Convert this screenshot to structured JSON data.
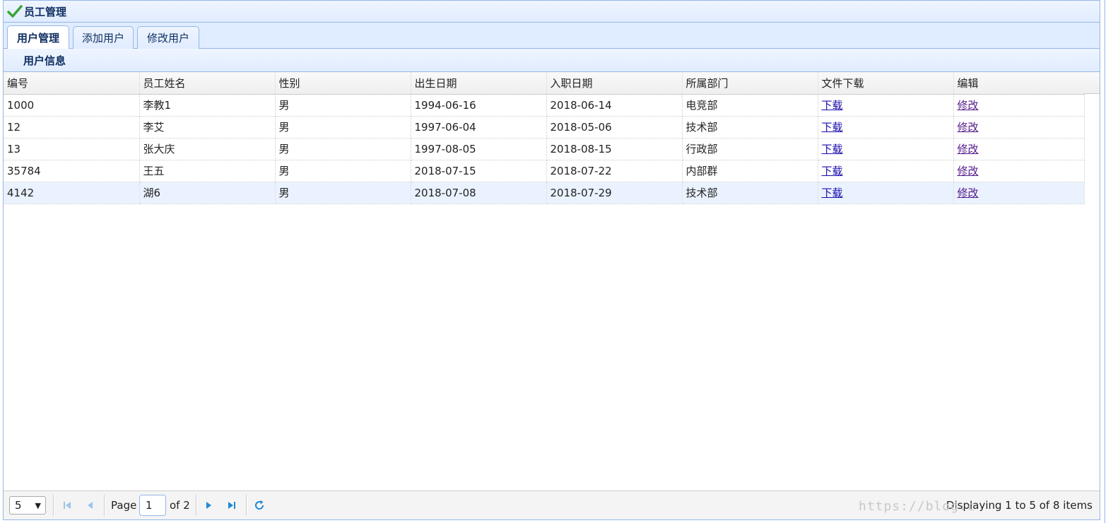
{
  "panel": {
    "title": "员工管理",
    "icon": "check-icon",
    "accent": "#95b8e7"
  },
  "tabs": [
    {
      "label": "用户管理",
      "active": true
    },
    {
      "label": "添加用户",
      "active": false
    },
    {
      "label": "修改用户",
      "active": false
    }
  ],
  "sub_panel": {
    "title": "用户信息"
  },
  "grid": {
    "columns": [
      "编号",
      "员工姓名",
      "性别",
      "出生日期",
      "入职日期",
      "所属部门",
      "文件下载",
      "编辑"
    ],
    "rows": [
      [
        "1000",
        "李教1",
        "男",
        "1994-06-16",
        "2018-06-14",
        "电竞部",
        "下载",
        "修改"
      ],
      [
        "12",
        "李艾",
        "男",
        "1997-06-04",
        "2018-05-06",
        "技术部",
        "下载",
        "修改"
      ],
      [
        "13",
        "张大庆",
        "男",
        "1997-08-05",
        "2018-08-15",
        "行政部",
        "下载",
        "修改"
      ],
      [
        "35784",
        "王五",
        "男",
        "2018-07-15",
        "2018-07-22",
        "内部群",
        "下载",
        "修改"
      ],
      [
        "4142",
        "湖6",
        "男",
        "2018-07-08",
        "2018-07-29",
        "技术部",
        "下载",
        "修改"
      ]
    ],
    "highlighted_row": 4
  },
  "pager": {
    "page_size": "5",
    "page_label": "Page",
    "current_page": "1",
    "of_label": "of 2",
    "display_text": "Displaying 1 to 5 of 8 items"
  },
  "watermark": "https://blog.c"
}
